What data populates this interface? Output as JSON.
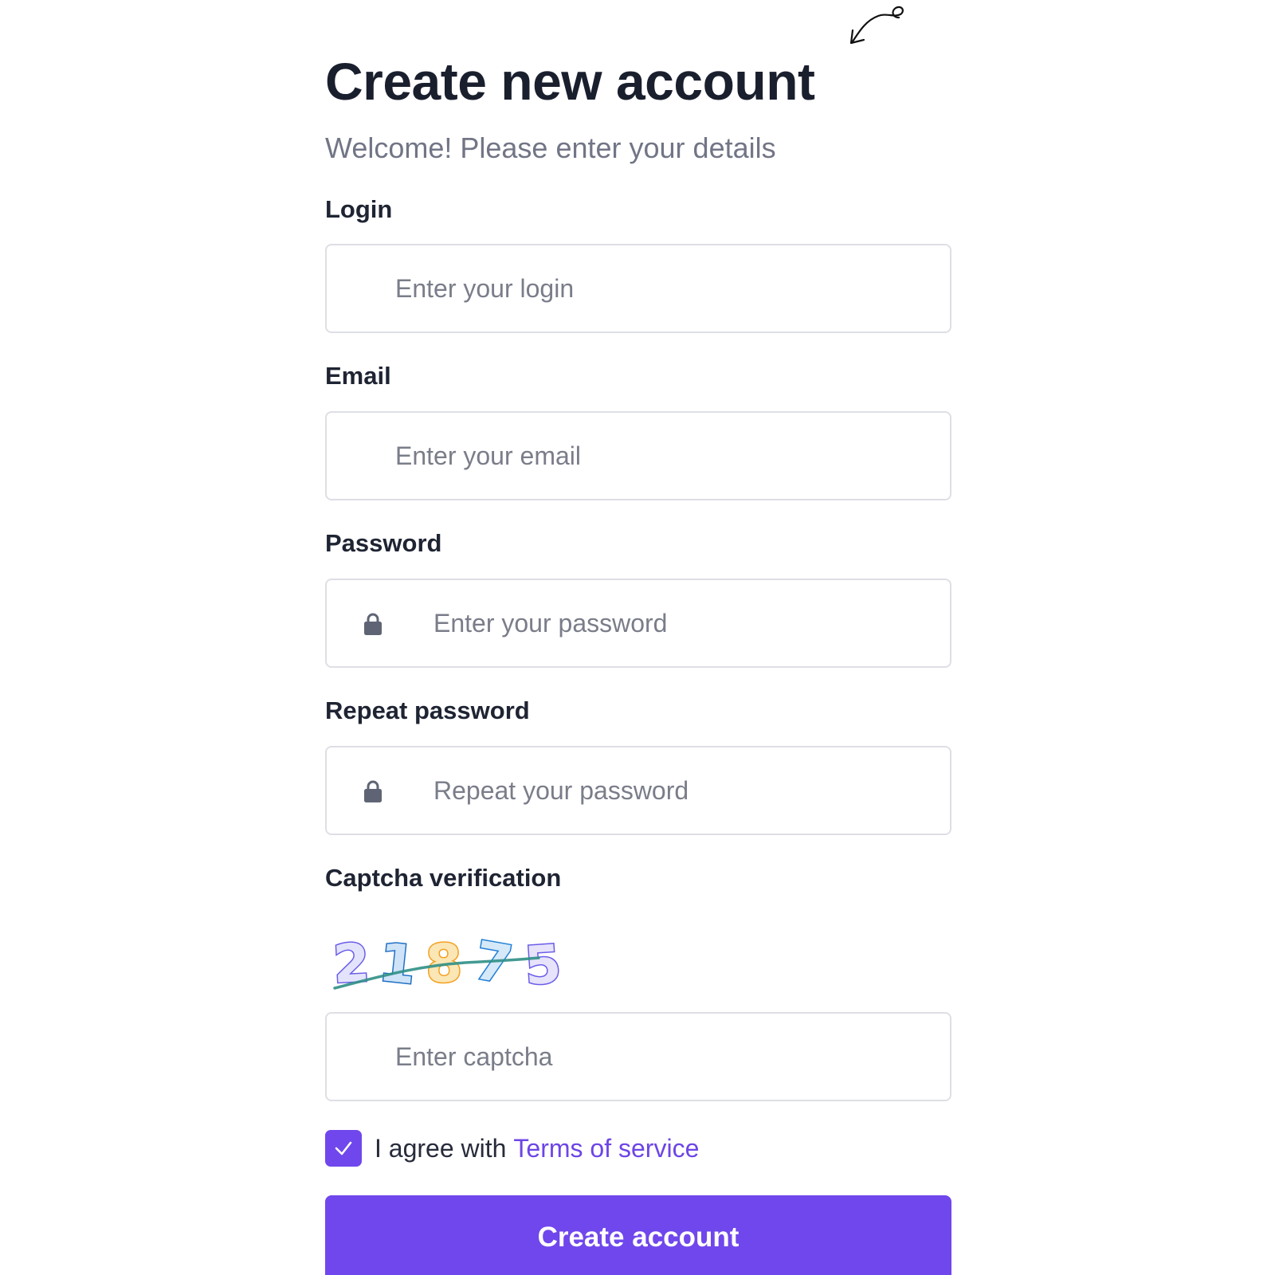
{
  "header": {
    "title": "Create new account",
    "subtitle": "Welcome! Please enter your details"
  },
  "fields": {
    "login": {
      "label": "Login",
      "placeholder": "Enter your login",
      "value": ""
    },
    "email": {
      "label": "Email",
      "placeholder": "Enter your email",
      "value": ""
    },
    "password": {
      "label": "Password",
      "placeholder": "Enter your password",
      "value": "",
      "icon": "lock-icon"
    },
    "repeat_password": {
      "label": "Repeat password",
      "placeholder": "Repeat your password",
      "value": "",
      "icon": "lock-icon"
    }
  },
  "captcha": {
    "label": "Captcha verification",
    "code": "21875",
    "placeholder": "Enter captcha",
    "value": ""
  },
  "terms": {
    "checked": true,
    "text": "I agree with",
    "link_text": "Terms of service"
  },
  "submit": {
    "label": "Create account"
  },
  "colors": {
    "accent": "#7047ec",
    "title": "#1a1f2e",
    "muted": "#717585",
    "border": "#dedfe5",
    "link": "#6d45e6"
  }
}
